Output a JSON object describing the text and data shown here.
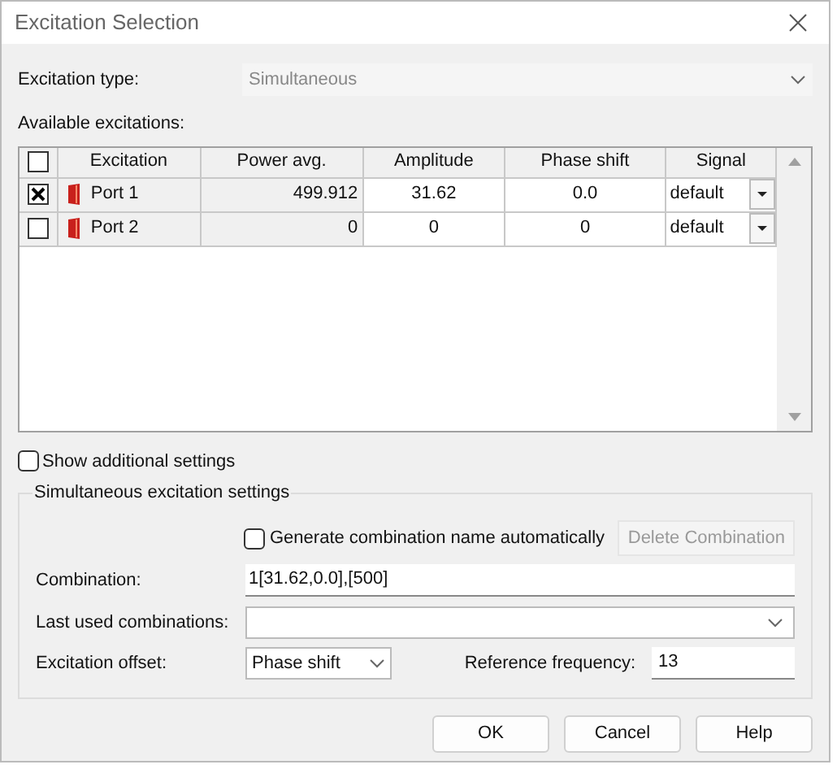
{
  "window": {
    "title": "Excitation Selection"
  },
  "excitation_type": {
    "label": "Excitation type:",
    "value": "Simultaneous",
    "disabled": true
  },
  "available_label": "Available excitations:",
  "table": {
    "header_checked": false,
    "columns": [
      "Excitation",
      "Power avg.",
      "Amplitude",
      "Phase shift",
      "Signal"
    ],
    "rows": [
      {
        "checked": true,
        "excitation": "Port 1",
        "power": "499.912",
        "amplitude": "31.62",
        "phase": "0.0",
        "signal": "default"
      },
      {
        "checked": false,
        "excitation": "Port 2",
        "power": "0",
        "amplitude": "0",
        "phase": "0",
        "signal": "default"
      }
    ]
  },
  "show_additional": {
    "label": "Show additional settings",
    "checked": false
  },
  "group": {
    "title": "Simultaneous excitation settings",
    "auto_name": {
      "label": "Generate combination name automatically",
      "checked": false
    },
    "delete_button": {
      "label": "Delete Combination",
      "disabled": true
    },
    "combination": {
      "label": "Combination:",
      "value": "1[31.62,0.0],[500]"
    },
    "last_used": {
      "label": "Last used combinations:"
    },
    "offset": {
      "label": "Excitation offset:",
      "value": "Phase shift"
    },
    "reference": {
      "label": "Reference frequency:",
      "value": "13"
    }
  },
  "buttons": [
    "OK",
    "Cancel",
    "Help"
  ]
}
